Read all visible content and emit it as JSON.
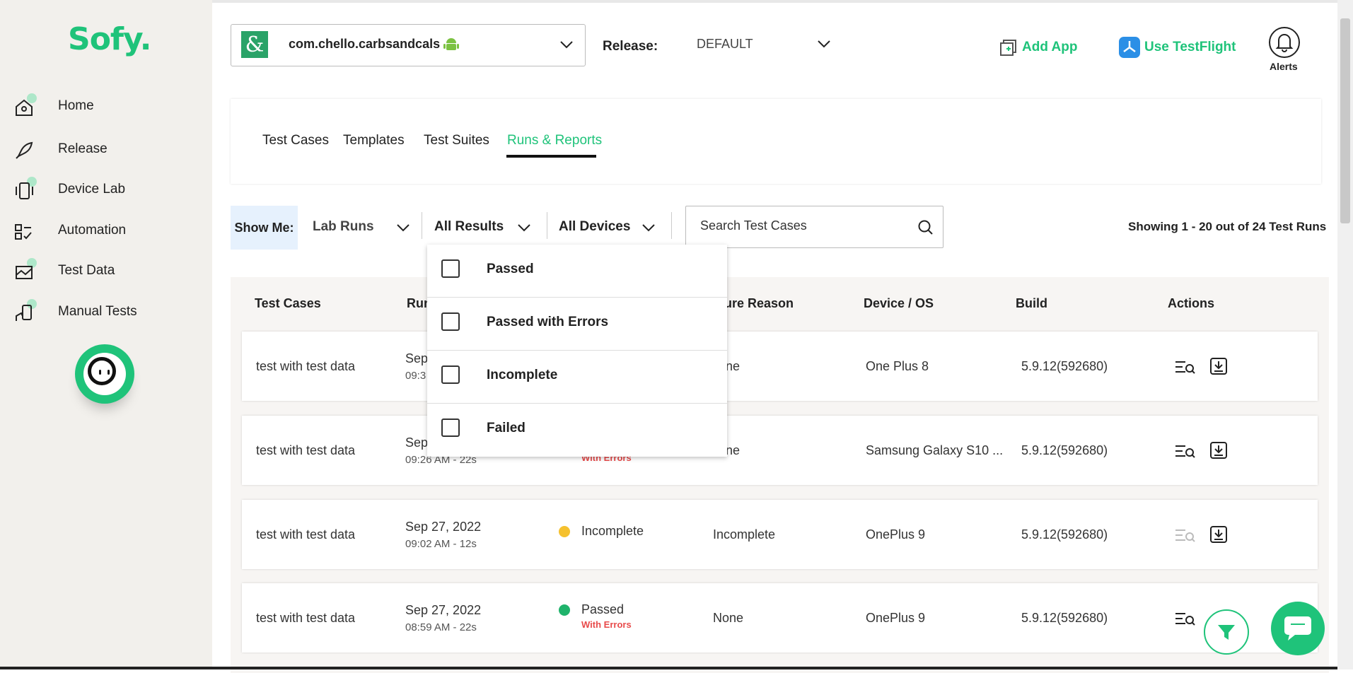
{
  "sidebar": {
    "logo": "Sofy.",
    "items": [
      {
        "label": "Home",
        "icon": "home-icon"
      },
      {
        "label": "Release",
        "icon": "rocket-icon"
      },
      {
        "label": "Device Lab",
        "icon": "device-icon"
      },
      {
        "label": "Automation",
        "icon": "automation-icon"
      },
      {
        "label": "Test Data",
        "icon": "test-data-icon"
      },
      {
        "label": "Manual Tests",
        "icon": "manual-tests-icon"
      }
    ]
  },
  "header": {
    "app_name": "com.chello.carbsandcals",
    "release_label": "Release:",
    "release_value": "DEFAULT",
    "add_app": "Add App",
    "use_testflight": "Use TestFlight",
    "alerts": "Alerts"
  },
  "tabs": [
    {
      "label": "Test Cases",
      "active": false
    },
    {
      "label": "Templates",
      "active": false
    },
    {
      "label": "Test Suites",
      "active": false
    },
    {
      "label": "Runs & Reports",
      "active": true
    }
  ],
  "filters": {
    "show_me": "Show Me:",
    "run_type": "Lab Runs",
    "results": "All Results",
    "devices": "All Devices",
    "search_placeholder": "Search Test Cases",
    "showing": "Showing 1 - 20 out of 24 Test Runs"
  },
  "results_menu": [
    "Passed",
    "Passed with Errors",
    "Incomplete",
    "Failed"
  ],
  "table": {
    "headers": [
      "Test Cases",
      "Run",
      "ilure Reason",
      "Device / OS",
      "Build",
      "Actions"
    ],
    "rows": [
      {
        "test_case": "test with test data",
        "date": "Sep",
        "time": "09:3",
        "status": "",
        "with_errors": "",
        "failure": "one",
        "device": "One Plus 8",
        "build": "5.9.12(592680)"
      },
      {
        "test_case": "test with test data",
        "date": "Sep",
        "time": "09:26 AM - 22s",
        "status": "",
        "with_errors": "With Errors",
        "failure": "one",
        "device": "Samsung Galaxy S10 ...",
        "build": "5.9.12(592680)"
      },
      {
        "test_case": "test with test data",
        "date": "Sep 27, 2022",
        "time": "09:02 AM - 12s",
        "status": "Incomplete",
        "with_errors": "",
        "failure": "Incomplete",
        "device": "OnePlus 9",
        "build": "5.9.12(592680)"
      },
      {
        "test_case": "test with test data",
        "date": "Sep 27, 2022",
        "time": "08:59 AM - 22s",
        "status": "Passed",
        "with_errors": "With Errors",
        "failure": "None",
        "device": "OnePlus 9",
        "build": "5.9.12(592680)"
      }
    ]
  },
  "colors": {
    "accent": "#1fc37a",
    "incomplete": "#f5c12e",
    "passed": "#1fb36b",
    "error": "#e84b4b"
  }
}
